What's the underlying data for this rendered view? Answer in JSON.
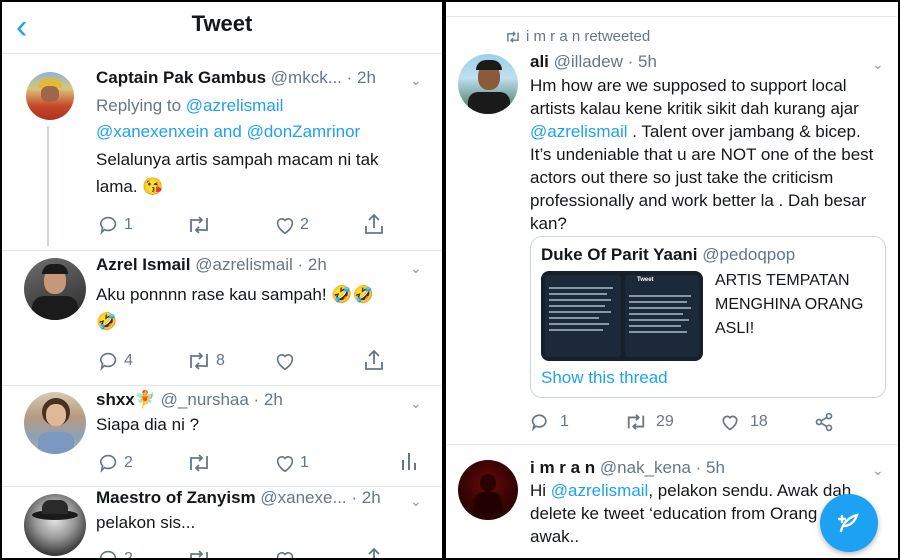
{
  "left": {
    "header": {
      "title": "Tweet"
    },
    "tweets": [
      {
        "name": "Captain Pak Gambus",
        "handle": "@mkck...",
        "time": "· 2h",
        "reply_prefix": "Replying to",
        "reply_to_1": "@azrelismail",
        "reply_to_2": "@xanexenxein",
        "reply_and": "and",
        "reply_to_3": "@donZamrinor",
        "text_1": "Selalunya artis sampah macam ni tak",
        "text_2": "lama. 😘",
        "replies": "1",
        "retweets": "",
        "likes": "2"
      },
      {
        "name": "Azrel Ismail",
        "handle": "@azrelismail",
        "time": "· 2h",
        "text_1": "Aku ponnnn rase kau sampah! 🤣🤣",
        "text_2": "🤣",
        "replies": "4",
        "retweets": "8",
        "likes": ""
      },
      {
        "name": "shxx",
        "name_emoji": "🧚",
        "handle": "@_nurshaa",
        "time": "· 2h",
        "text_1": "Siapa dia ni ?",
        "replies": "2",
        "retweets": "",
        "likes": "1"
      },
      {
        "name": "Maestro of Zanyism",
        "handle": "@xanexe...",
        "time": "· 2h",
        "text_1": "pelakon sis...",
        "replies": "2"
      }
    ]
  },
  "right": {
    "retweeted_by": "i m r a n retweeted",
    "main": {
      "name": "ali",
      "handle": "@illadew",
      "time": "· 5h",
      "lines": [
        "Hm how are we supposed to support local",
        "artists kalau kene kritik sikit dah kurang ajar",
        "@azrelismail",
        " . Talent over jambang & bicep.",
        "It’s undeniable that u are NOT one of the best",
        "actors out there so just take the criticism",
        "professionally and work better la . Dah besar",
        "kan?"
      ],
      "quote": {
        "name": "Duke Of Parit Yaani",
        "handle": "@pedoqpop",
        "text_1": "ARTIS TEMPATAN",
        "text_2": "MENGHINA ORANG",
        "text_3": "ASLI!",
        "show_thread": "Show this thread",
        "img_title": "Tweet"
      },
      "replies": "1",
      "retweets": "29",
      "likes": "18"
    },
    "second": {
      "name": "i m r a n",
      "handle": "@nak_kena",
      "time": "· 5h",
      "line1_pre": "Hi ",
      "line1_mention": "@azrelismail",
      "line1_post": ", pelakon sendu. Awak dah",
      "line2": "delete ke tweet ‘education from Orang",
      "line3": "awak.."
    }
  },
  "colors": {
    "accent": "#1da1f2",
    "grey": "#657786",
    "border": "#e1e8ed"
  }
}
